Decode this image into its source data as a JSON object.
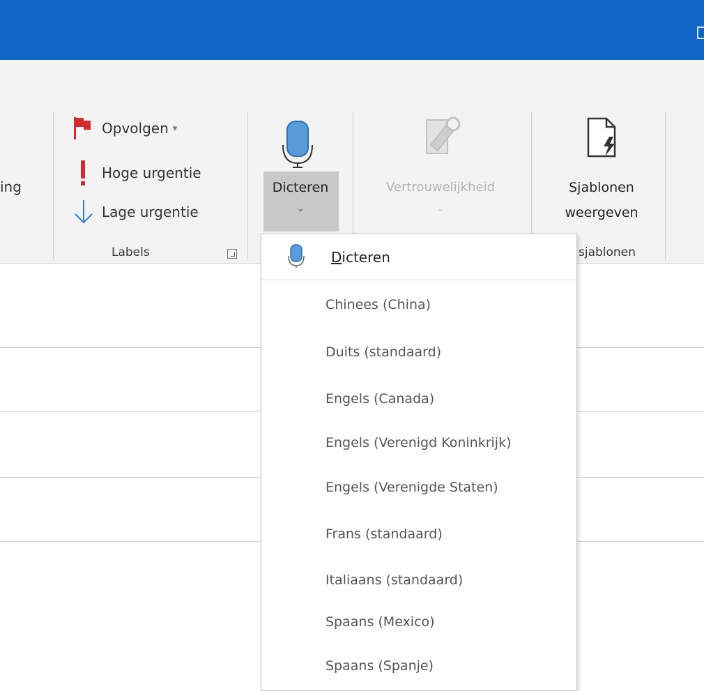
{
  "ribbon": {
    "partial_left_text": "ing",
    "labels_group": {
      "items": [
        {
          "label": "Opvolgen",
          "has_dropdown": true,
          "icon": "flag-icon",
          "color": "#d42b2b"
        },
        {
          "label": "Hoge urgentie",
          "icon": "exclamation-icon",
          "color": "#d42b2b"
        },
        {
          "label": "Lage urgentie",
          "icon": "arrow-down-icon",
          "color": "#2f7fd2"
        }
      ],
      "group_label": "Labels"
    },
    "dicteren_button": {
      "label": "Dicteren",
      "icon": "microphone-icon",
      "has_dropdown": true
    },
    "vertrouwelijkheid_button": {
      "label": "Vertrouwelijkheid",
      "disabled": true,
      "icon": "sensitivity-icon"
    },
    "sjablonen_button": {
      "label_line1": "Sjablonen",
      "label_line2": "weergeven",
      "icon": "template-icon"
    },
    "sjablonen_group_label": "sjablonen"
  },
  "dictate_menu": {
    "header_label_first": "D",
    "header_label_rest": "icteren",
    "languages": [
      "Chinees (China)",
      "Duits (standaard)",
      "Engels (Canada)",
      "Engels (Verenigd Koninkrijk)",
      "Engels (Verenigde Staten)",
      "Frans (standaard)",
      "Italiaans (standaard)",
      "Spaans (Mexico)",
      "Spaans (Spanje)"
    ]
  },
  "colors": {
    "titlebar": "#0f66c4",
    "ribbon_bg": "#f3f3f3",
    "mic_blue": "#5a9bdc"
  }
}
